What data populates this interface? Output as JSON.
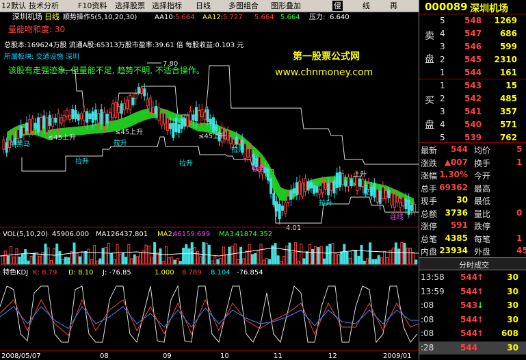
{
  "menubar": {
    "items": [
      "12默认",
      "技术分析",
      "F10资料",
      "选择股票",
      "选择指标",
      "日线",
      "多图组合",
      "图形叠加",
      "侵",
      "线",
      "再"
    ]
  },
  "chart": {
    "header": {
      "name": "深圳机场",
      "period": "日线",
      "indicator": "顺势操作5(5,10,20,30)",
      "aa10_label": "AA10:",
      "aa10_value": "5.664",
      "aa12_label": "AA12:",
      "aa12_value": "5.727",
      "v3": "5.664",
      "v4": "5.664",
      "pressure_label": "压力:",
      "pressure_value": "6.640"
    },
    "info": {
      "qnmhd": "量能吻和度: 30",
      "line2": "总股本:169624万股 流通A股:65313万股市盈率:39.61 倍   每股收益:0.103 元",
      "line3": "所属板块: 交通设施 深圳",
      "advice": "该股有走强迹象, 但量能不足, 趋势不明, 不适合操作。",
      "watermark1": "第一股票公式网",
      "watermark2": "www.chnmoney.com"
    },
    "annotations": {
      "high": "7.80",
      "low": "4.01",
      "s1": "≤45上升",
      "s2": "≤45上升",
      "s3": "≤45上升",
      "s4": "上升",
      "l1": "拉升",
      "l2": "拉升",
      "l3": "拉升",
      "l4": "拉升",
      "l5": "拉升",
      "l6": "拉升",
      "m1": "牛黑马",
      "m2": "强势",
      "m3": "连线"
    },
    "vol": {
      "label": "VOL(5,10,20)",
      "v": "45906.000",
      "ma1_label": "MA1:",
      "ma1": "26437.801",
      "ma2_label": "MA2:",
      "ma2": "46159.699",
      "ma3_label": "MA3:",
      "ma3": "41874.352"
    },
    "kdj": {
      "label": "特色KDJ",
      "k": "K: 8.79",
      "d": "D: 8.10",
      "j": "J: -76.85",
      "x1": "1.000",
      "x2": "8.789",
      "x3": "8.104",
      "x4": "-76.854"
    },
    "dates": [
      "2008/05/07",
      "08",
      "09",
      "10",
      "11",
      "12",
      "2009/01"
    ]
  },
  "quote": {
    "code": "000089",
    "name": "深圳机场",
    "sell_label1": "卖",
    "sell_label2": "盘",
    "buy_label1": "买",
    "buy_label2": "盘",
    "sells": [
      {
        "lvl": "5",
        "price": "548",
        "vol": "1269"
      },
      {
        "lvl": "4",
        "price": "547",
        "vol": "686"
      },
      {
        "lvl": "3",
        "price": "546",
        "vol": "599"
      },
      {
        "lvl": "2",
        "price": "545",
        "vol": "2310"
      },
      {
        "lvl": "1",
        "price": "544",
        "vol": "161"
      }
    ],
    "buys": [
      {
        "lvl": "1",
        "price": "543",
        "vol": "15"
      },
      {
        "lvl": "2",
        "price": "542",
        "vol": "485"
      },
      {
        "lvl": "3",
        "price": "541",
        "vol": "357"
      },
      {
        "lvl": "4",
        "price": "540",
        "vol": "571"
      },
      {
        "lvl": "5",
        "price": "539",
        "vol": "762"
      }
    ],
    "stats": [
      {
        "l1": "最新",
        "v1": "544",
        "l2": "均价",
        "v2": "5"
      },
      {
        "l1": "涨跌",
        "v1": "▲007",
        "l2": "换手",
        "v2": "1"
      },
      {
        "l1": "涨幅",
        "v1": "1.30%",
        "l2": "今开",
        "v2": ""
      },
      {
        "l1": "总手",
        "v1": "69362",
        "l2": "最高",
        "v2": ""
      },
      {
        "l1": "现手",
        "v1": "30",
        "l2": "最低",
        "v2": ""
      },
      {
        "l1": "总额",
        "v1": "3736",
        "l2": "量比",
        "v2": "0"
      },
      {
        "l1": "涨停",
        "v1": "591",
        "l2": "跌停",
        "v2": ""
      },
      {
        "l1": "总笔",
        "v1": "4385",
        "l2": "每笔",
        "v2": "1"
      },
      {
        "l1": "内盘",
        "v1": "23934",
        "l2": "外盘",
        "v2": "45"
      }
    ],
    "ticks_title": "分时成交",
    "ticks": [
      {
        "t": "13:58",
        "p": "544",
        "arrow": "↑",
        "v": "30"
      },
      {
        "t": "13:59",
        "p": "544",
        "arrow": "↑",
        "v": "30"
      },
      {
        "t": ":08",
        "p": "543",
        "arrow": "↓",
        "v": "30"
      },
      {
        "t": ":08",
        "p": "544",
        "arrow": "↑",
        "v": "30"
      },
      {
        "t": ":08",
        "p": "544",
        "arrow": "↑",
        "v": "608"
      },
      {
        "t": ":28",
        "p": "544",
        "arrow": "",
        "v": "30"
      }
    ]
  }
}
